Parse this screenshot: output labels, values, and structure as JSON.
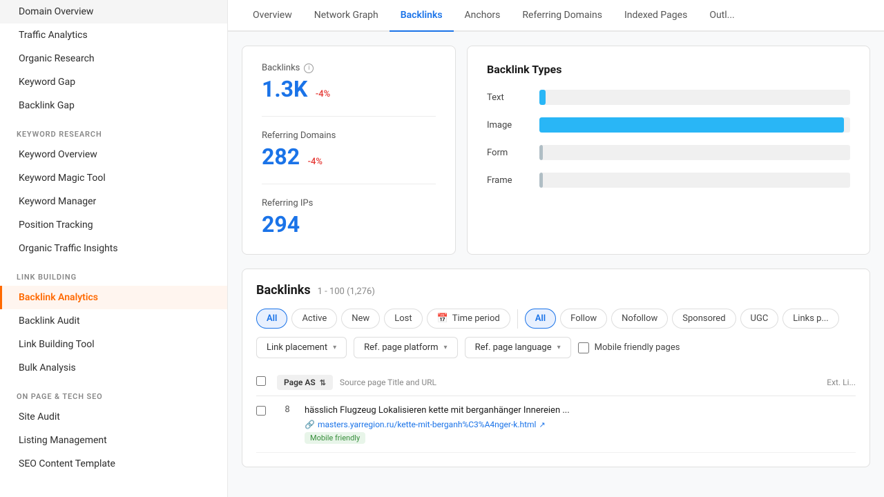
{
  "sidebar": {
    "sections": [
      {
        "label": null,
        "items": [
          {
            "id": "domain-overview",
            "label": "Domain Overview",
            "active": false
          },
          {
            "id": "traffic-analytics",
            "label": "Traffic Analytics",
            "active": false
          },
          {
            "id": "organic-research",
            "label": "Organic Research",
            "active": false
          },
          {
            "id": "keyword-gap",
            "label": "Keyword Gap",
            "active": false
          },
          {
            "id": "backlink-gap",
            "label": "Backlink Gap",
            "active": false
          }
        ]
      },
      {
        "label": "KEYWORD RESEARCH",
        "items": [
          {
            "id": "keyword-overview",
            "label": "Keyword Overview",
            "active": false
          },
          {
            "id": "keyword-magic-tool",
            "label": "Keyword Magic Tool",
            "active": false
          },
          {
            "id": "keyword-manager",
            "label": "Keyword Manager",
            "active": false
          },
          {
            "id": "position-tracking",
            "label": "Position Tracking",
            "active": false
          },
          {
            "id": "organic-traffic-insights",
            "label": "Organic Traffic Insights",
            "active": false
          }
        ]
      },
      {
        "label": "LINK BUILDING",
        "items": [
          {
            "id": "backlink-analytics",
            "label": "Backlink Analytics",
            "active": true
          },
          {
            "id": "backlink-audit",
            "label": "Backlink Audit",
            "active": false
          },
          {
            "id": "link-building-tool",
            "label": "Link Building Tool",
            "active": false
          },
          {
            "id": "bulk-analysis",
            "label": "Bulk Analysis",
            "active": false
          }
        ]
      },
      {
        "label": "ON PAGE & TECH SEO",
        "items": [
          {
            "id": "site-audit",
            "label": "Site Audit",
            "active": false
          },
          {
            "id": "listing-management",
            "label": "Listing Management",
            "active": false
          },
          {
            "id": "seo-content-template",
            "label": "SEO Content Template",
            "active": false
          }
        ]
      }
    ]
  },
  "topNav": {
    "tabs": [
      {
        "id": "overview",
        "label": "Overview",
        "active": false
      },
      {
        "id": "network-graph",
        "label": "Network Graph",
        "active": false
      },
      {
        "id": "backlinks",
        "label": "Backlinks",
        "active": true
      },
      {
        "id": "anchors",
        "label": "Anchors",
        "active": false
      },
      {
        "id": "referring-domains",
        "label": "Referring Domains",
        "active": false
      },
      {
        "id": "indexed-pages",
        "label": "Indexed Pages",
        "active": false
      },
      {
        "id": "outl",
        "label": "Outl...",
        "active": false
      }
    ]
  },
  "statsCard": {
    "backlinks_label": "Backlinks",
    "backlinks_value": "1.3K",
    "backlinks_change": "-4%",
    "referring_domains_label": "Referring Domains",
    "referring_domains_value": "282",
    "referring_domains_change": "-4%",
    "referring_ips_label": "Referring IPs",
    "referring_ips_value": "294"
  },
  "backlinkTypes": {
    "title": "Backlink Types",
    "types": [
      {
        "label": "Text",
        "percent": 2,
        "color": "#29b6f6"
      },
      {
        "label": "Image",
        "percent": 98,
        "color": "#29b6f6"
      },
      {
        "label": "Form",
        "percent": 1,
        "color": "#b0bec5"
      },
      {
        "label": "Frame",
        "percent": 1,
        "color": "#b0bec5"
      }
    ]
  },
  "backlinksSection": {
    "title": "Backlinks",
    "count_range": "1 - 100 (1,276)",
    "filter_tabs_1": {
      "tabs": [
        {
          "id": "all-1",
          "label": "All",
          "active": true
        },
        {
          "id": "active",
          "label": "Active",
          "active": false
        },
        {
          "id": "new",
          "label": "New",
          "active": false
        },
        {
          "id": "lost",
          "label": "Lost",
          "active": false
        },
        {
          "id": "time-period",
          "label": "Time period",
          "active": false,
          "icon": "calendar"
        }
      ]
    },
    "filter_tabs_2": {
      "tabs": [
        {
          "id": "all-2",
          "label": "All",
          "active": true
        },
        {
          "id": "follow",
          "label": "Follow",
          "active": false
        },
        {
          "id": "nofollow",
          "label": "Nofollow",
          "active": false
        },
        {
          "id": "sponsored",
          "label": "Sponsored",
          "active": false
        },
        {
          "id": "ugc",
          "label": "UGC",
          "active": false
        },
        {
          "id": "links-p",
          "label": "Links p...",
          "active": false
        }
      ]
    },
    "dropdowns": [
      {
        "id": "link-placement",
        "label": "Link placement"
      },
      {
        "id": "ref-page-platform",
        "label": "Ref. page platform"
      },
      {
        "id": "ref-page-language",
        "label": "Ref. page language"
      }
    ],
    "mobile_friendly_label": "Mobile friendly pages",
    "table": {
      "col_page_as": "Page AS",
      "col_source": "Source page Title and URL",
      "col_ext_li": "Ext. Li...",
      "rows": [
        {
          "page_as": "8",
          "title": "hässlich Flugzeug Lokalisieren kette mit berganhänger Innereien ...",
          "url": "masters.yarregion.ru/kette-mit-berganh%C3%A4nger-k.html",
          "badge": "Mobile friendly"
        }
      ]
    }
  }
}
